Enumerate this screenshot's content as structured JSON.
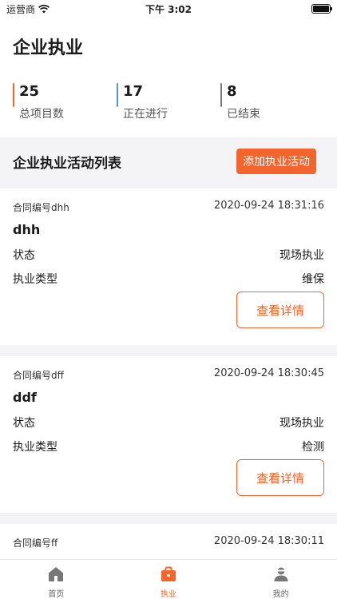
{
  "status_bar": {
    "carrier": "运营商",
    "time": "下午 3:02"
  },
  "header": {
    "title": "企业执业",
    "stats": [
      {
        "value": "25",
        "label": "总项目数",
        "color": "#f4652e"
      },
      {
        "value": "17",
        "label": "正在进行",
        "color": "#5b8fd6"
      },
      {
        "value": "8",
        "label": "已结束",
        "color": "#777777"
      }
    ]
  },
  "list": {
    "title": "企业执业活动列表",
    "add_label": "添加执业活动",
    "status_label": "状态",
    "type_label": "执业类型",
    "detail_label": "查看详情",
    "items": [
      {
        "contract": "合同编号dhh",
        "timestamp": "2020-09-24 18:31:16",
        "name": "dhh",
        "status": "现场执业",
        "type": "维保"
      },
      {
        "contract": "合同编号dff",
        "timestamp": "2020-09-24 18:30:45",
        "name": "ddf",
        "status": "现场执业",
        "type": "检测"
      },
      {
        "contract": "合同编号ff",
        "timestamp": "2020-09-24 18:30:11"
      }
    ]
  },
  "tabbar": {
    "items": [
      {
        "label": "首页",
        "icon": "home-icon"
      },
      {
        "label": "执业",
        "icon": "briefcase-icon"
      },
      {
        "label": "我的",
        "icon": "user-icon"
      }
    ],
    "active_color": "#f4652e"
  }
}
